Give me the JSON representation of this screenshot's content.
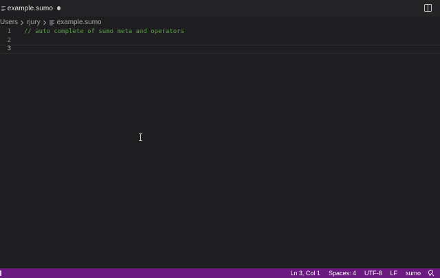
{
  "tab": {
    "label": "example.sumo",
    "dirty": true
  },
  "breadcrumb": {
    "items": [
      "Users",
      "rjury",
      "example.sumo"
    ]
  },
  "editor": {
    "lines": [
      {
        "number": "1",
        "text": "// auto complete of sumo meta and operators"
      },
      {
        "number": "2",
        "text": ""
      },
      {
        "number": "3",
        "text": ""
      }
    ],
    "current_line": "3"
  },
  "statusbar": {
    "position": "Ln 3, Col 1",
    "indent": "Spaces: 4",
    "encoding": "UTF-8",
    "eol": "LF",
    "language": "sumo"
  },
  "colors": {
    "statusbar_bg": "#6a1b7f",
    "comment": "#5ca04a",
    "editor_bg": "#1e1e20"
  },
  "icons": {
    "tab_file": "file-lines-icon",
    "split": "split-editor-icon",
    "breadcrumb_sep": "chevron-right-icon",
    "feedback": "feedback-icon"
  }
}
